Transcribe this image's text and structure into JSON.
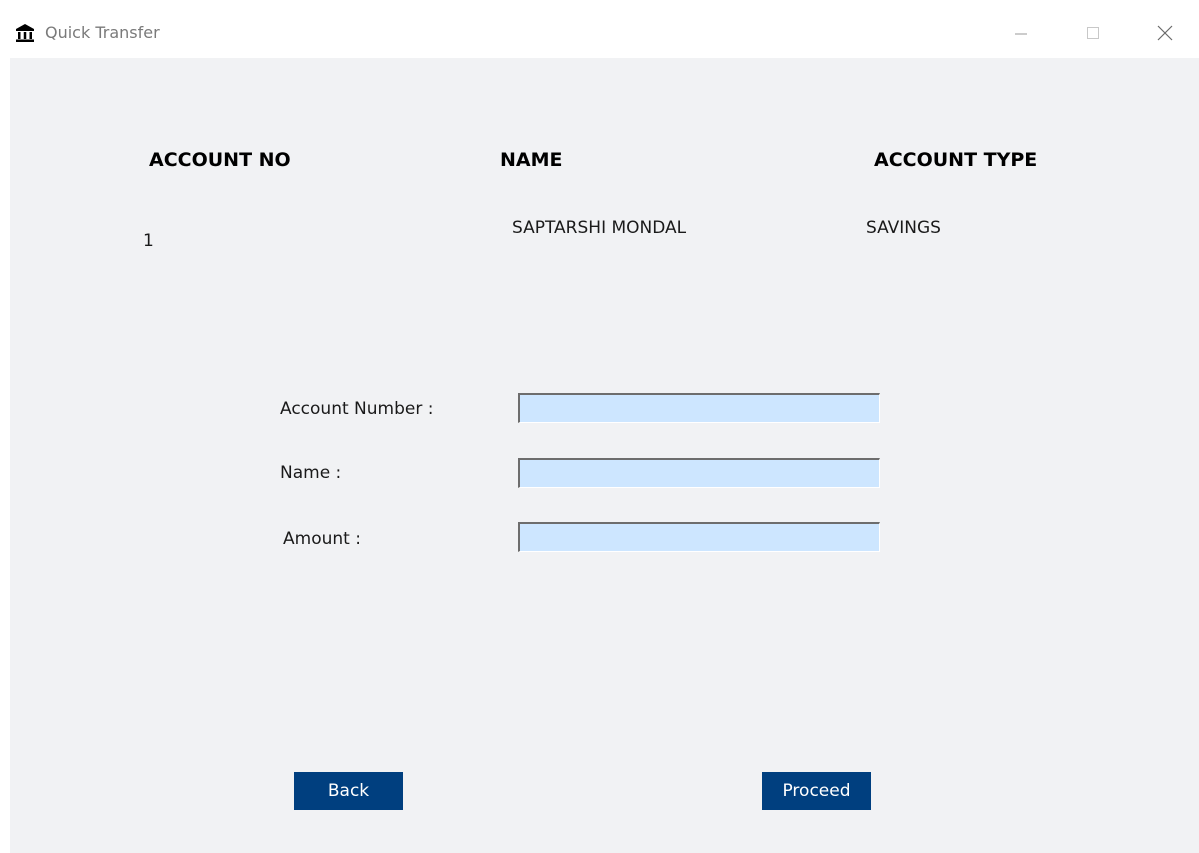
{
  "window": {
    "title": "Quick Transfer",
    "icon": "bank-icon"
  },
  "table": {
    "headers": [
      "ACCOUNT NO",
      "NAME",
      "ACCOUNT TYPE"
    ],
    "row": {
      "account_no": "1",
      "name": "SAPTARSHI MONDAL",
      "account_type": "SAVINGS"
    }
  },
  "form": {
    "account_number_label": "Account Number :",
    "account_number_value": "",
    "name_label": "Name :",
    "name_value": "",
    "amount_label": "Amount :",
    "amount_value": ""
  },
  "buttons": {
    "back": "Back",
    "proceed": "Proceed"
  },
  "colors": {
    "button_bg": "#003f7f",
    "input_bg": "#cde6ff",
    "client_bg": "#f1f2f4"
  }
}
